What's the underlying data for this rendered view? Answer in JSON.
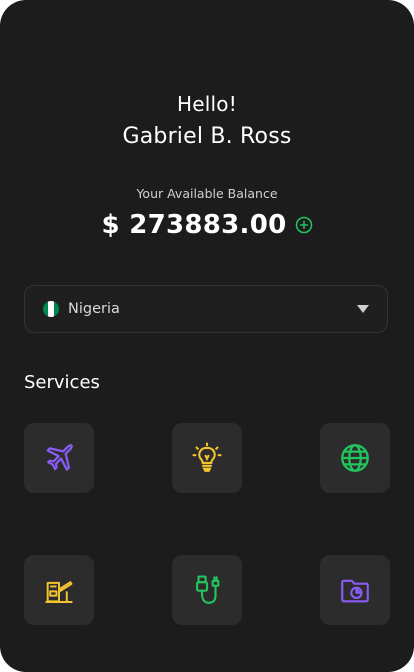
{
  "header": {
    "greeting": "Hello!",
    "user_name": "Gabriel B. Ross"
  },
  "balance": {
    "label": "Your Available Balance",
    "value": "$ 273883.00",
    "add_icon": "plus-circle-icon"
  },
  "country_select": {
    "selected": "Nigeria",
    "flag_icon": "nigeria-flag-icon",
    "chevron_icon": "triangle-down-icon"
  },
  "services": {
    "title": "Services",
    "items": [
      {
        "icon": "airplane-icon",
        "color": "#8a5cf6"
      },
      {
        "icon": "lightbulb-icon",
        "color": "#f4c430"
      },
      {
        "icon": "globe-icon",
        "color": "#22c55e"
      },
      {
        "icon": "toll-gate-icon",
        "color": "#f4c430"
      },
      {
        "icon": "usb-cable-icon",
        "color": "#22c55e"
      },
      {
        "icon": "folder-chart-icon",
        "color": "#8a5cf6"
      }
    ]
  },
  "colors": {
    "background": "#1c1c1c",
    "tile": "#2c2c2c",
    "accent_green": "#22c55e",
    "accent_purple": "#8a5cf6",
    "accent_yellow": "#f4c430"
  }
}
